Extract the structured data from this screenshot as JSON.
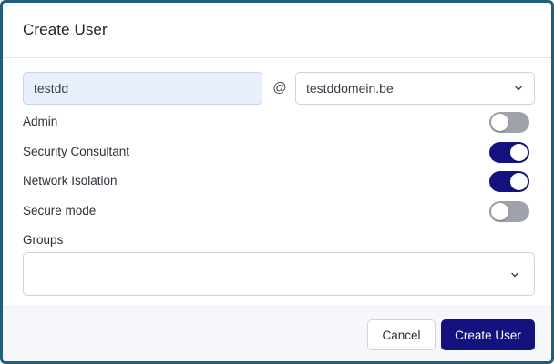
{
  "dialog": {
    "title": "Create User"
  },
  "form": {
    "username": {
      "value": "testdd",
      "placeholder": ""
    },
    "at_symbol": "@",
    "domain": {
      "selected": "testddomein.be"
    },
    "toggles": [
      {
        "label": "Admin",
        "checked": false
      },
      {
        "label": "Security Consultant",
        "checked": true
      },
      {
        "label": "Network Isolation",
        "checked": true
      },
      {
        "label": "Secure mode",
        "checked": false
      }
    ],
    "groups": {
      "label": "Groups",
      "selected": ""
    }
  },
  "footer": {
    "cancel_label": "Cancel",
    "create_label": "Create User"
  },
  "colors": {
    "accent": "#14127f",
    "frame": "#1f5f7a",
    "toggle_off": "#9ea3ab",
    "input_fill": "#e8f0fe"
  },
  "icons": {
    "dropdown": "chevron-down-icon"
  }
}
